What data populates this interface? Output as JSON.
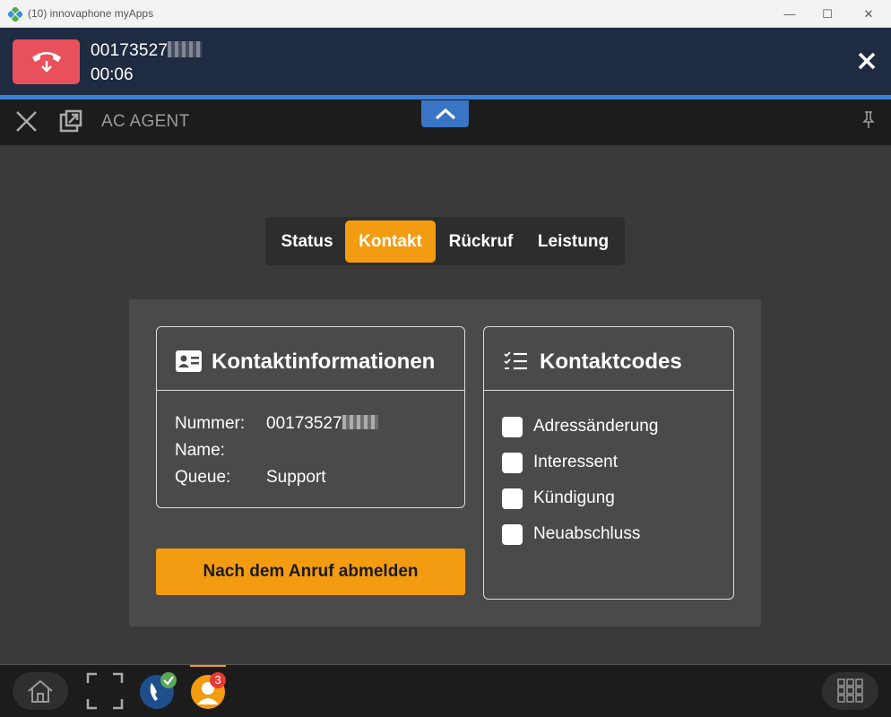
{
  "window": {
    "title": "(10) innovaphone myApps",
    "minimize": "—",
    "maximize": "☐",
    "close": "✕"
  },
  "call": {
    "number_prefix": "00173527",
    "duration": "00:06",
    "colors": {
      "bar": "#1f2b41",
      "hangup": "#e8505b",
      "progress": "#3a7fd5"
    }
  },
  "app_header": {
    "title": "AC AGENT"
  },
  "tabs": [
    {
      "label": "Status",
      "active": false
    },
    {
      "label": "Kontakt",
      "active": true
    },
    {
      "label": "Rückruf",
      "active": false
    },
    {
      "label": "Leistung",
      "active": false
    }
  ],
  "contact_info": {
    "title": "Kontaktinformationen",
    "rows": [
      {
        "label": "Nummer:",
        "value": "00173527"
      },
      {
        "label": "Name:",
        "value": ""
      },
      {
        "label": "Queue:",
        "value": "Support"
      }
    ]
  },
  "logout_button": {
    "label": "Nach dem Anruf abmelden"
  },
  "contact_codes": {
    "title": "Kontaktcodes",
    "items": [
      {
        "label": "Adressänderung",
        "checked": false
      },
      {
        "label": "Interessent",
        "checked": false
      },
      {
        "label": "Kündigung",
        "checked": false
      },
      {
        "label": "Neuabschluss",
        "checked": false
      }
    ]
  },
  "taskbar": {
    "agent_badge": "3",
    "icons": [
      "home-icon",
      "fullscreen-icon",
      "phone-app-icon",
      "agent-app-icon",
      "apps-grid-icon"
    ]
  },
  "colors": {
    "accent": "#f39c12",
    "background": "#3a3a3a",
    "panel": "#4a4a4a"
  }
}
